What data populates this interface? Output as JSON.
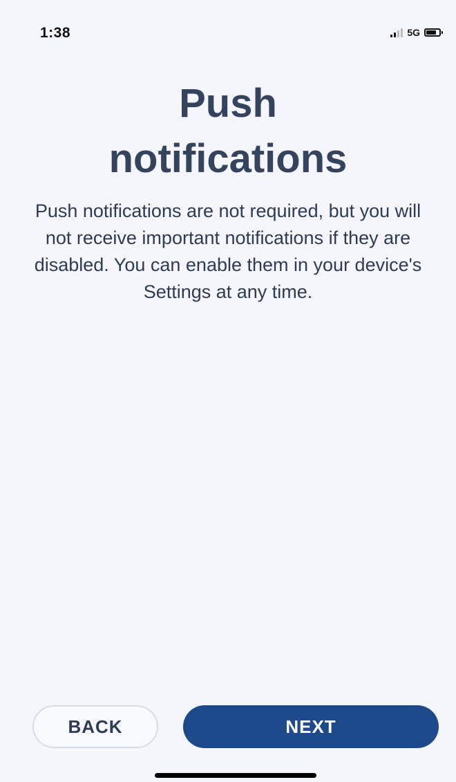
{
  "status_bar": {
    "time": "1:38",
    "network": "5G",
    "signal_icon": "signal-bars-icon",
    "battery_icon": "battery-icon"
  },
  "screen": {
    "title_line1": "Push",
    "title_line2": "notifications",
    "description": "Push notifications are not required, but you will not receive important notifications if they are disabled. You can enable them in your device's Settings at any time."
  },
  "buttons": {
    "back_label": "BACK",
    "next_label": "NEXT"
  },
  "colors": {
    "background": "#f4f6fb",
    "title": "#34435e",
    "primary": "#1e4a8c",
    "secondary_border": "#d5dbe7"
  }
}
